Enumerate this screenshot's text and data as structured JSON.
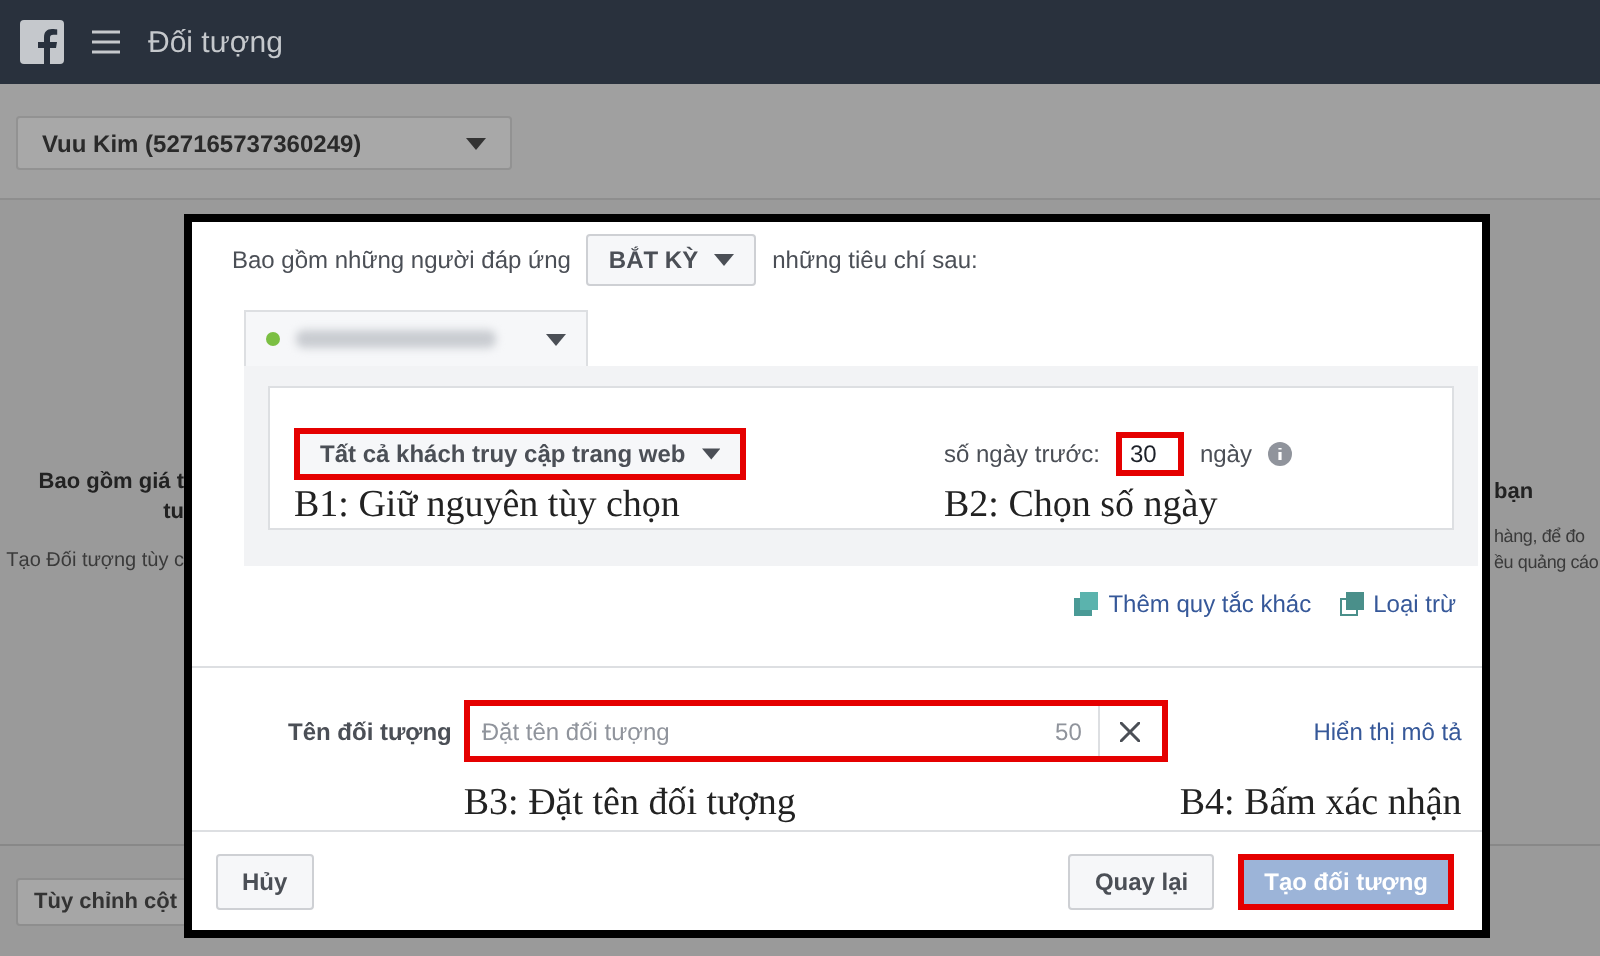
{
  "top_bar": {
    "title": "Đối tượng"
  },
  "account_selector": {
    "value": "Vuu Kim (527165737360249)"
  },
  "background": {
    "left_card": {
      "title_lines": [
        "Bao gồm giá t",
        "tu"
      ],
      "text": "Tạo Đối tượng tùy c"
    },
    "right_card": {
      "title": "bạn",
      "lines": [
        "hàng, để đo",
        "ều quảng cáo"
      ]
    },
    "footer_button": "Tùy chỉnh cột"
  },
  "dialog": {
    "include_prefix": "Bao gồm những người đáp ứng",
    "match_select": "BẮT KỲ",
    "include_suffix": "những tiêu chí sau:",
    "rule": {
      "source": "Tất cả khách truy cập trang web",
      "source_highlighted": true,
      "days_label": "số ngày trước:",
      "days": "30",
      "days_highlighted": true,
      "days_unit": "ngày"
    },
    "rule_annotations": [
      {
        "text": "B1: Giữ nguyên tùy chọn"
      },
      {
        "text": "B2: Chọn số ngày"
      }
    ],
    "links": [
      {
        "kind": "add",
        "label": "Thêm quy tắc khác"
      },
      {
        "kind": "exclude",
        "label": "Loại trừ"
      }
    ],
    "name_label": "Tên đối tượng",
    "name_placeholder": "Đặt tên đối tượng",
    "name_counter": "50",
    "name_highlighted": true,
    "show_description": "Hiển thị mô tả",
    "name_annotations": [
      {
        "text": "B3: Đặt tên đối tượng"
      },
      {
        "text": "B4: Bấm xác nhận"
      }
    ],
    "cancel": "Hủy",
    "back": "Quay lại",
    "create": {
      "label": "Tạo đối tượng",
      "disabled": true,
      "highlighted": true
    }
  }
}
